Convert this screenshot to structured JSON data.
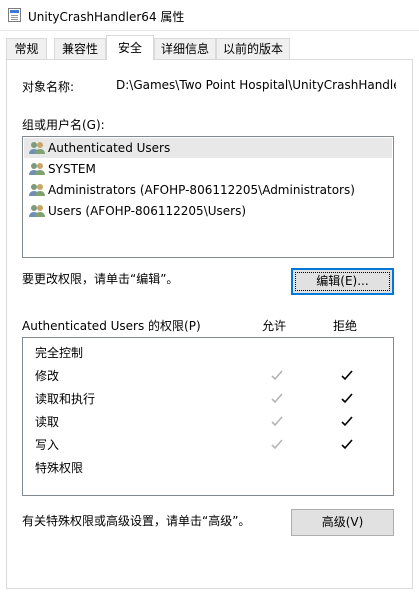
{
  "window": {
    "title": "UnityCrashHandler64 属性"
  },
  "tabs": [
    {
      "label": "常规"
    },
    {
      "label": "兼容性"
    },
    {
      "label": "安全"
    },
    {
      "label": "详细信息"
    },
    {
      "label": "以前的版本"
    }
  ],
  "active_tab": "安全",
  "object": {
    "label": "对象名称:",
    "value": "D:\\Games\\Two Point Hospital\\UnityCrashHandle"
  },
  "groups": {
    "label": "组或用户名(G):",
    "items": [
      {
        "name": "Authenticated Users",
        "selected": true
      },
      {
        "name": "SYSTEM",
        "selected": false
      },
      {
        "name": "Administrators (AFOHP-806112205\\Administrators)",
        "selected": false
      },
      {
        "name": "Users (AFOHP-806112205\\Users)",
        "selected": false
      }
    ],
    "icon": "users-icon"
  },
  "edit": {
    "hint": "要更改权限，请单击“编辑”。",
    "button_label": "编辑(E)..."
  },
  "permissions": {
    "title": "Authenticated Users 的权限(P)",
    "allow_header": "允许",
    "deny_header": "拒绝",
    "rows": [
      {
        "name": "完全控制",
        "allow": false,
        "deny": false
      },
      {
        "name": "修改",
        "allow": true,
        "deny": true
      },
      {
        "name": "读取和执行",
        "allow": true,
        "deny": true
      },
      {
        "name": "读取",
        "allow": true,
        "deny": true
      },
      {
        "name": "写入",
        "allow": true,
        "deny": true
      },
      {
        "name": "特殊权限",
        "allow": false,
        "deny": false
      }
    ],
    "allow_check_color": "#b4b4b4",
    "deny_check_color": "#000000"
  },
  "advanced": {
    "hint": "有关特殊权限或高级设置，请单击“高级”。",
    "button_label": "高级(V)"
  },
  "colors": {
    "focus_border": "#0078d7",
    "selected_row": "#e8e8e8"
  }
}
